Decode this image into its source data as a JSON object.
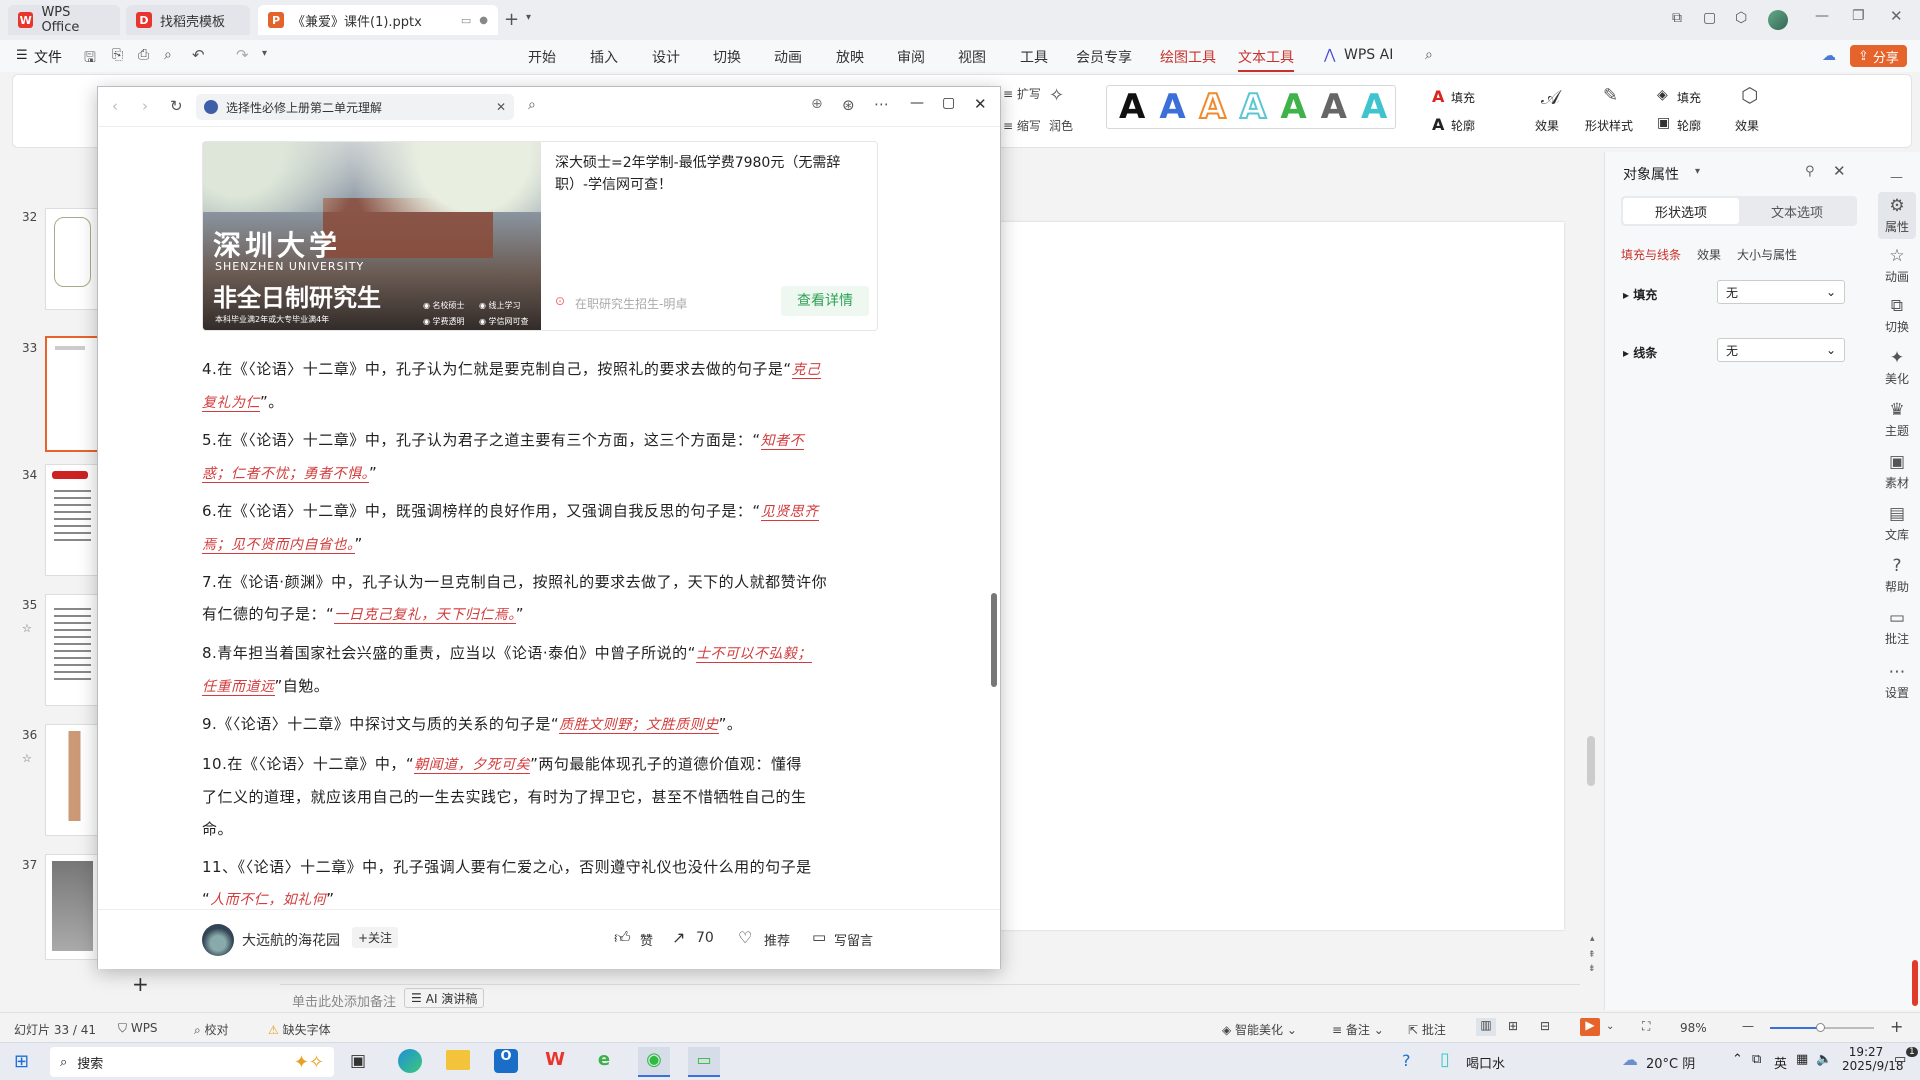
{
  "tabs": [
    {
      "label": "WPS Office"
    },
    {
      "label": "找稻壳模板"
    },
    {
      "label": "《兼爱》课件(1).pptx"
    }
  ],
  "menu": {
    "file": "文件",
    "items": [
      "开始",
      "插入",
      "设计",
      "切换",
      "动画",
      "放映",
      "审阅",
      "视图",
      "工具",
      "会员专享",
      "绘图工具",
      "文本工具",
      "WPS AI"
    ],
    "share": "分享"
  },
  "ribbon": {
    "expand": "扩写",
    "shrink": "缩写",
    "polish": "润色",
    "fill": "填充",
    "outline": "轮廓",
    "effect": "效果",
    "shape_style": "形状样式",
    "fill2": "填充",
    "outline2": "轮廓",
    "effect2": "效果",
    "art_letter": "A"
  },
  "slides": {
    "numbers": [
      "32",
      "33",
      "34",
      "35",
      "36",
      "37"
    ]
  },
  "browser": {
    "tab_title": "选择性必修上册第二单元理解",
    "ad": {
      "school_cn": "深圳大学",
      "school_en": "SHENZHEN UNIVERSITY",
      "headline": "非全日制研究生",
      "sub": "本科毕业满2年或大专毕业满4年",
      "bullets": [
        "名校硕士",
        "线上学习",
        "学费透明",
        "学信网可查"
      ],
      "text": "深大硕士=2年学制-最低学费7980元（无需辞职）-学信网可查！",
      "source": "在职研究生招生-明卓",
      "cta": "查看详情"
    },
    "questions": [
      {
        "pre": "4.在《〈论语〉十二章》中，孔子认为仁就是要克制自己，按照礼的要求去做的句子是“",
        "a1": "克己",
        "line2a": "复礼为仁",
        "post": "”。"
      },
      {
        "pre": "5.在《〈论语〉十二章》中，孔子认为君子之道主要有三个方面，这三个方面是：“",
        "a1": "知者不",
        "line2a": "惑；仁者不忧；勇者不惧。",
        "post": "”"
      },
      {
        "pre": "6.在《〈论语〉十二章》中，既强调榜样的良好作用，又强调自我反思的句子是：“",
        "a1": "见贤思齐",
        "line2a": "焉；见不贤而内自省也。",
        "post": "”"
      },
      {
        "pre": "7.在《论语·颜渊》中，孔子认为一旦克制自己，按照礼的要求去做了，天下的人就都赞许你",
        "a1": "",
        "line2pre": "有仁德的句子是：“",
        "line2a": "一日克己复礼，天下归仁焉。",
        "post": "”"
      },
      {
        "pre": "8.青年担当着国家社会兴盛的重责，应当以《论语·泰伯》中曾子所说的“",
        "a1": "士不可以不弘毅；",
        "line2a": "任重而道远",
        "post": "”自勉。"
      },
      {
        "pre": "9.《〈论语〉十二章》中探讨文与质的关系的句子是“",
        "a1": "质胜文则野；文胜质则史",
        "post": "”。"
      },
      {
        "pre": "10.在《〈论语〉十二章》中，“",
        "a1": "朝闻道，夕死可矣",
        "mid": "”两句最能体现孔子的道德价值观：懂得",
        "line2": "了仁义的道理，就应该用自己的一生去实践它，有时为了捍卫它，甚至不惜牺牲自己的生",
        "line3": "命。"
      },
      {
        "pre": "11、《〈论语〉十二章》中，孔子强调人要有仁爱之心，否则遵守礼仪也没什么用的句子是",
        "line2pre": "“",
        "line2a": "人而不仁，如礼何",
        "post": "”"
      }
    ],
    "footer": {
      "author": "大远航的海花园",
      "follow": "+关注",
      "like": "赞",
      "share_count": "70",
      "recommend": "推荐",
      "comment": "写留言"
    }
  },
  "right_panel": {
    "title": "对象属性",
    "tab1": "形状选项",
    "tab2": "文本选项",
    "sub1": "填充与线条",
    "sub2": "效果",
    "sub3": "大小与属性",
    "fill_label": "填充",
    "fill_value": "无",
    "line_label": "线条",
    "line_value": "无"
  },
  "right_bar": [
    "属性",
    "动画",
    "切换",
    "美化",
    "主题",
    "素材",
    "文库",
    "帮助",
    "批注",
    "设置"
  ],
  "status": {
    "slide": "幻灯片 33 / 41",
    "wps": "WPS",
    "proof": "校对",
    "missing_font": "缺失字体",
    "notes_hint": "单击此处添加备注",
    "ai_speech": "AI 演讲稿",
    "beautify": "智能美化",
    "notes": "备注",
    "comment": "批注",
    "zoom": "98%"
  },
  "taskbar": {
    "search": "搜索",
    "drink": "喝口水",
    "weather": "20°C 阴",
    "ime": "英",
    "time": "19:27",
    "date": "2025/9/18",
    "notif": "1"
  }
}
